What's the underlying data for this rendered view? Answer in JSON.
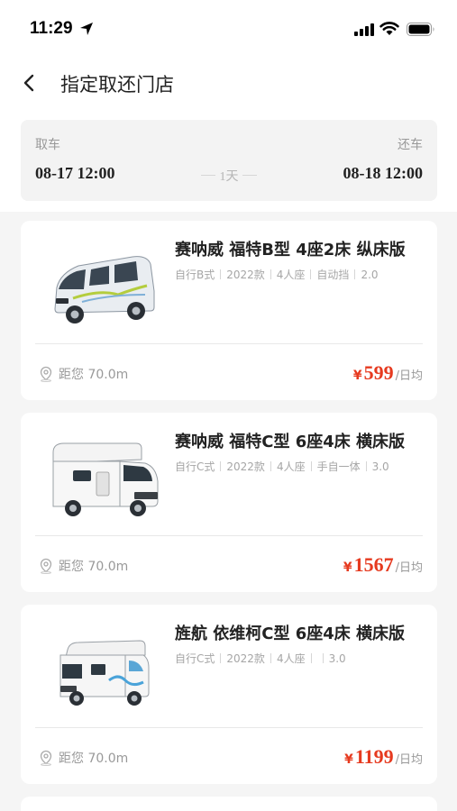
{
  "status_bar": {
    "time": "11:29"
  },
  "nav": {
    "title": "指定取还门店"
  },
  "rental": {
    "pickup_label": "取车",
    "pickup_datetime": "08-17 12:00",
    "duration": "1天",
    "return_label": "还车",
    "return_datetime": "08-18 12:00"
  },
  "vehicles": [
    {
      "name": "赛呐威 福特B型 4座2床 纵床版",
      "specs": [
        "自行B式",
        "2022款",
        "4人座",
        "自动挡",
        "2.0"
      ],
      "distance": "距您 70.0m",
      "currency": "¥",
      "price": "599",
      "price_unit": "/日均",
      "image": "van-b-type"
    },
    {
      "name": "赛呐威 福特C型 6座4床 横床版",
      "specs": [
        "自行C式",
        "2022款",
        "4人座",
        "手自一体",
        "3.0"
      ],
      "distance": "距您 70.0m",
      "currency": "¥",
      "price": "1567",
      "price_unit": "/日均",
      "image": "rv-c-type"
    },
    {
      "name": "旌航 依维柯C型 6座4床 横床版",
      "specs": [
        "自行C式",
        "2022款",
        "4人座",
        "",
        "3.0"
      ],
      "distance": "距您 70.0m",
      "currency": "¥",
      "price": "1199",
      "price_unit": "/日均",
      "image": "rv-iveco"
    }
  ]
}
